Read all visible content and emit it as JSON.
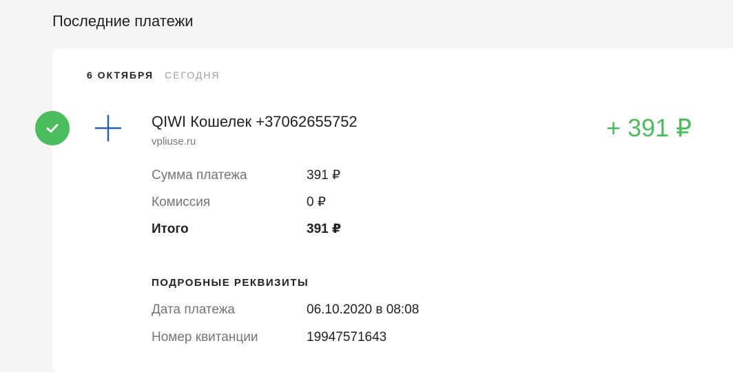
{
  "page": {
    "title": "Последние платежи"
  },
  "colors": {
    "success": "#4bbd5c",
    "icon_blue": "#1f5fbf",
    "background": "#f5f5f5",
    "card": "#ffffff"
  },
  "date_group": {
    "date": "6 ОКТЯБРЯ",
    "relative": "СЕГОДНЯ"
  },
  "transaction": {
    "status_icon": "check-icon",
    "type_icon": "plus-icon",
    "title": "QIWI Кошелек +37062655752",
    "subtitle": "vpliuse.ru",
    "amount": "+ 391 ₽",
    "summary": [
      {
        "label": "Сумма платежа",
        "value": "391 ₽"
      },
      {
        "label": "Комиссия",
        "value": "0 ₽"
      },
      {
        "label": "Итого",
        "value": "391 ₽"
      }
    ],
    "details_title": "ПОДРОБНЫЕ РЕКВИЗИТЫ",
    "details": [
      {
        "label": "Дата платежа",
        "value": "06.10.2020 в 08:08"
      },
      {
        "label": "Номер квитанции",
        "value": "19947571643"
      }
    ]
  }
}
